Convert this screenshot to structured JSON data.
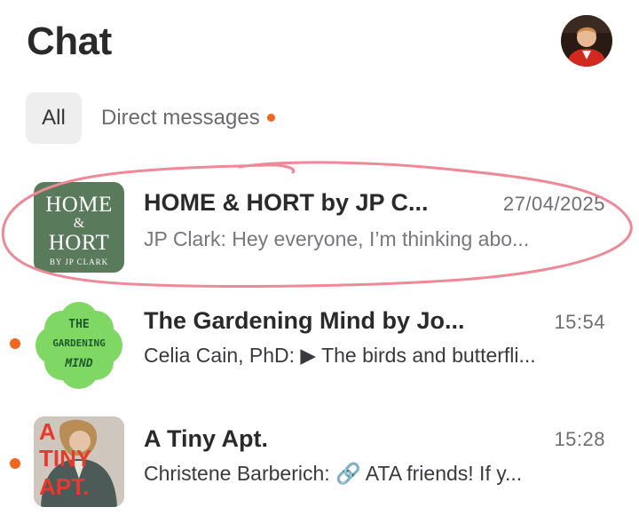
{
  "header": {
    "title": "Chat"
  },
  "tabs": [
    {
      "label": "All",
      "selected": true
    },
    {
      "label": "Direct messages",
      "has_unread_dot": true
    }
  ],
  "colors": {
    "accent_dot": "#f2661e",
    "annotation_circle": "#ee8a97",
    "hort_green": "#5a7a5c",
    "gardening_green": "#7fd864"
  },
  "chats": [
    {
      "title": "HOME & HORT by JP C...",
      "time": "27/04/2025",
      "preview": "JP Clark: Hey everyone, I’m thinking abo...",
      "unread": false,
      "thumb": {
        "line1": "HOME",
        "line2": "&",
        "line3": "HORT",
        "line4": "BY JP CLARK"
      }
    },
    {
      "title": "The Gardening Mind by Jo...",
      "time": "15:54",
      "preview": "Celia Cain, PhD: ▶ The birds and butterfli...",
      "unread": true,
      "thumb": {
        "line1": "THE",
        "line2": "GARDENING",
        "line3": "MIND"
      }
    },
    {
      "title": "A Tiny Apt.",
      "time": "15:28",
      "preview": "Christene Barberich: 🔗 ATA friends! If y...",
      "unread": true,
      "thumb": {
        "line1": "A",
        "line2": "TINY",
        "line3": "APT."
      }
    }
  ]
}
